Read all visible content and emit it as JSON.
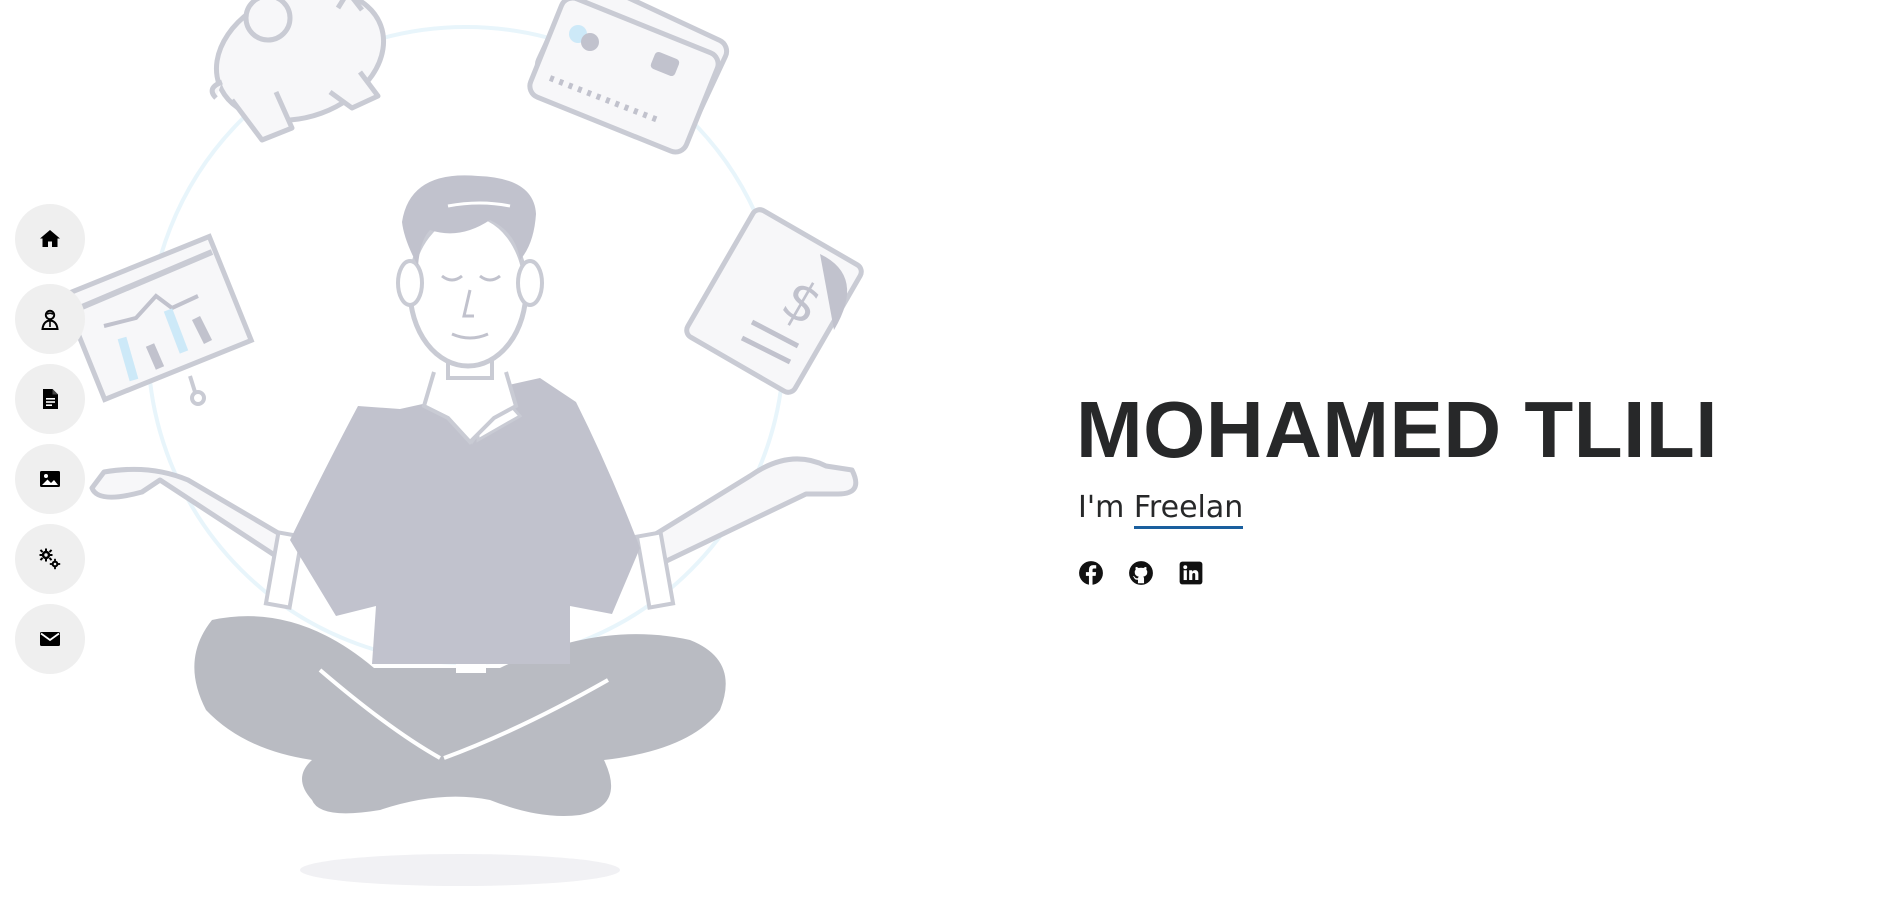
{
  "nav": {
    "items": [
      {
        "icon": "home-icon"
      },
      {
        "icon": "person-icon"
      },
      {
        "icon": "document-icon"
      },
      {
        "icon": "image-icon"
      },
      {
        "icon": "gears-icon"
      },
      {
        "icon": "envelope-icon"
      }
    ],
    "button_bg": "#efefef"
  },
  "hero": {
    "name": "MOHAMED TLILI",
    "tagline_prefix": "I'm ",
    "tagline_typed": "Freelan",
    "text_color": "#272829",
    "accent": "#1a5f9e",
    "social": [
      {
        "icon": "facebook-icon"
      },
      {
        "icon": "github-icon"
      },
      {
        "icon": "linkedin-icon"
      }
    ]
  },
  "illustration": {
    "subject": "meditating-man-icon",
    "figure_color": "#c1c2cd",
    "legs_color": "#b9bbc2",
    "outline_color": "#c9cbd4",
    "highlight_color": "#cde9f8"
  }
}
